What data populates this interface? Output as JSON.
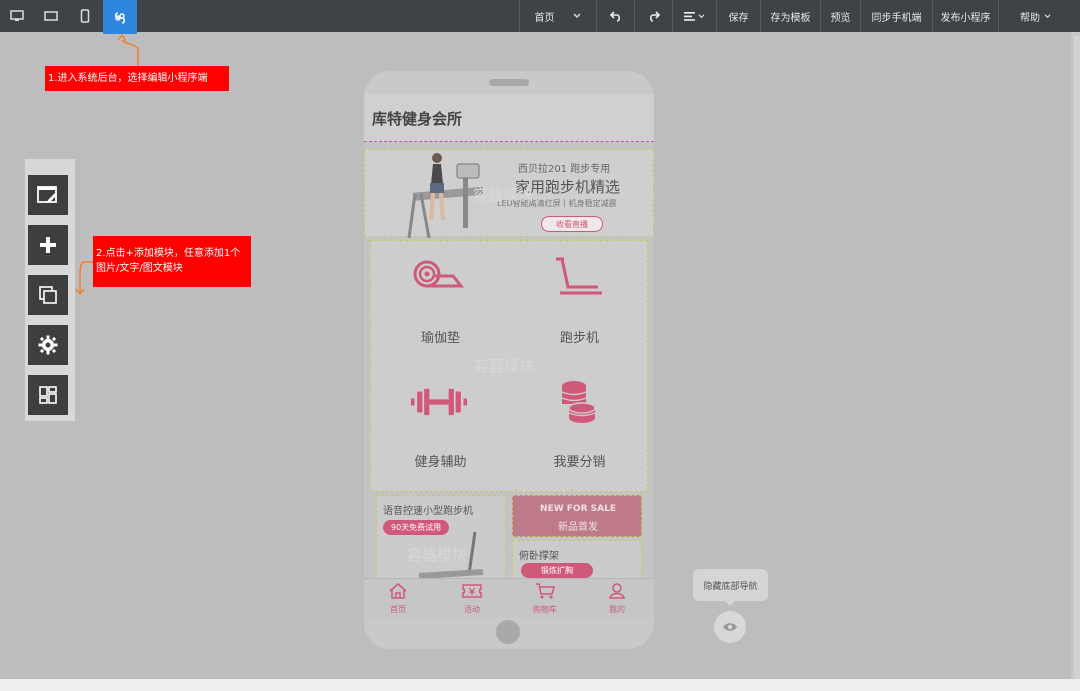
{
  "toolbar": {
    "devices": [
      "desktop-icon",
      "tablet-icon",
      "mobile-icon",
      "miniprogram-icon"
    ],
    "home_label": "首页",
    "save_label": "保存",
    "save_template_label": "存为模板",
    "preview_label": "预览",
    "sync_mobile_label": "同步手机端",
    "publish_label": "发布小程序",
    "help_label": "帮助",
    "active_color": "#2e86de"
  },
  "annotations": {
    "note1": "1.进入系统后台，选择编辑小程序端",
    "note2": "2.点击+添加模块，任意添加1个图片/文字/图文模块",
    "color": "#ff0000"
  },
  "tool_panel": [
    "edit-page-icon",
    "add-module-icon",
    "copy-icon",
    "settings-icon",
    "layout-icon"
  ],
  "phone": {
    "app_title": "库特健身会所",
    "banner": {
      "line1": "西贝拉201  跑步专用",
      "line2": "家用跑步机精选",
      "line3": "LED智能高清红屏丨机身稳定减震",
      "button": "收看直播"
    },
    "container_label": "容器模块",
    "grid": [
      {
        "label": "瑜伽垫",
        "icon": "yoga-mat-icon"
      },
      {
        "label": "跑步机",
        "icon": "treadmill-icon"
      },
      {
        "label": "健身辅助",
        "icon": "dumbbell-icon"
      },
      {
        "label": "我要分销",
        "icon": "coins-icon"
      }
    ],
    "cards": {
      "card1_title": "语音控速小型跑步机",
      "card1_badge": "90天免费试用",
      "card2_title": "NEW FOR SALE",
      "card2_sub": "新品首发",
      "card3_title": "俯卧撑架",
      "card3_badge": "锻炼扩胸"
    },
    "tabs": [
      {
        "label": "首页",
        "icon": "home-icon"
      },
      {
        "label": "活动",
        "icon": "ticket-icon"
      },
      {
        "label": "购物车",
        "icon": "cart-icon"
      },
      {
        "label": "我的",
        "icon": "user-icon"
      }
    ],
    "accent": "#d05878"
  },
  "hide_nav_label": "隐藏底部导航"
}
